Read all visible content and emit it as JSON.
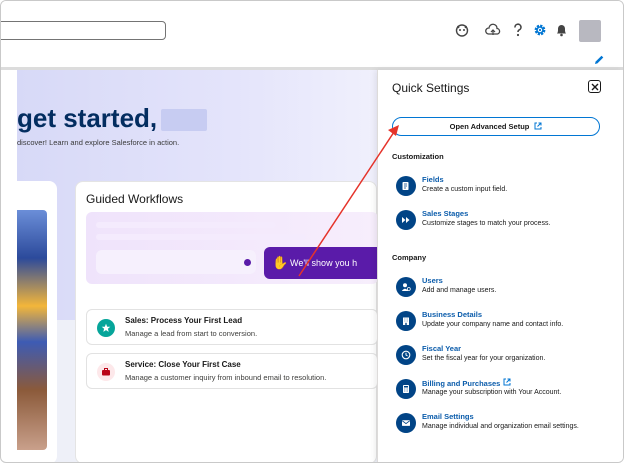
{
  "header": {
    "search_placeholder": "",
    "icons": [
      "astro-icon",
      "cloud-upload-icon",
      "help-icon",
      "setup-gear-icon",
      "notification-bell-icon"
    ]
  },
  "hero": {
    "title": "get started,",
    "subtitle": "discover! Learn and explore Salesforce in action."
  },
  "guided_workflows": {
    "title": "Guided Workflows",
    "banner_button": "We'll show you h",
    "tasks": [
      {
        "title": "Sales: Process Your First Lead",
        "desc": "Manage a lead from start to conversion.",
        "color": "#06a59a"
      },
      {
        "title": "Service: Close Your First Case",
        "desc": "Manage a customer inquiry from inbound email to resolution.",
        "color": "#ba0517"
      }
    ]
  },
  "quick_settings": {
    "title": "Quick Settings",
    "advanced_setup": "Open Advanced Setup",
    "customization": {
      "heading": "Customization",
      "items": [
        {
          "title": "Fields",
          "desc": "Create a custom input field."
        },
        {
          "title": "Sales Stages",
          "desc": "Customize stages to match your process."
        }
      ]
    },
    "company": {
      "heading": "Company",
      "items": [
        {
          "title": "Users",
          "desc": "Add and manage users."
        },
        {
          "title": "Business Details",
          "desc": "Update your company name and contact info."
        },
        {
          "title": "Fiscal Year",
          "desc": "Set the fiscal year for your organization."
        },
        {
          "title": "Billing and Purchases",
          "desc": "Manage your subscription with Your Account."
        },
        {
          "title": "Email Settings",
          "desc": "Manage individual and organization email settings."
        }
      ]
    }
  },
  "colors": {
    "brand_blue": "#0176d3",
    "navy": "#014486",
    "annotation_red": "#e5332a",
    "purple": "#5a1ba9"
  }
}
